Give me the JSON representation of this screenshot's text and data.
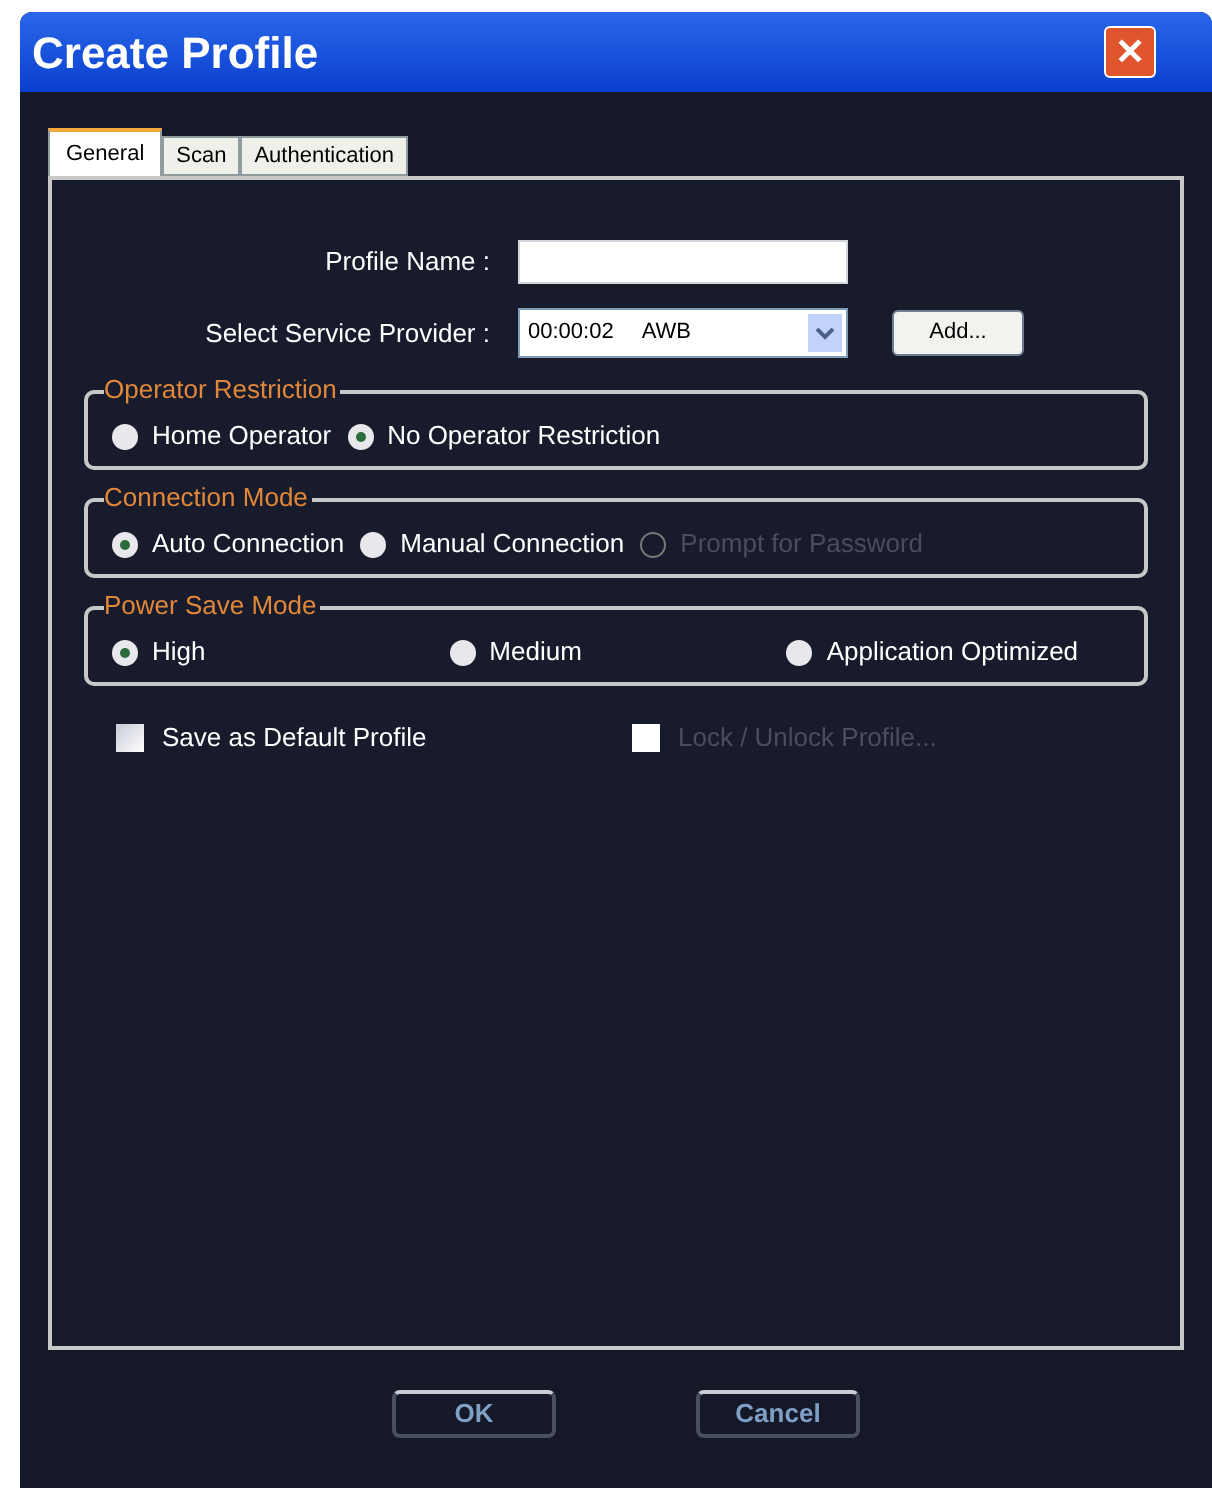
{
  "window": {
    "title": "Create Profile",
    "close": "✕"
  },
  "tabs": [
    {
      "label": "General",
      "selected": true
    },
    {
      "label": "Scan",
      "selected": false
    },
    {
      "label": "Authentication",
      "selected": false
    }
  ],
  "profile_name": {
    "label": "Profile Name :"
  },
  "service_provider": {
    "label": "Select Service Provider :",
    "value_id": "00:00:02",
    "value_name": "AWB",
    "button": "Add..."
  },
  "groups": [
    {
      "title": "Operator Restriction",
      "spread": false,
      "options": [
        {
          "label": "Home Operator",
          "selected": false,
          "disabled": false
        },
        {
          "label": "No Operator Restriction",
          "selected": true,
          "disabled": false
        }
      ]
    },
    {
      "title": "Connection Mode",
      "spread": false,
      "options": [
        {
          "label": "Auto Connection",
          "selected": true,
          "disabled": false
        },
        {
          "label": "Manual Connection",
          "selected": false,
          "disabled": false
        },
        {
          "label": "Prompt for Password",
          "selected": false,
          "disabled": true
        }
      ]
    },
    {
      "title": "Power Save Mode",
      "spread": true,
      "options": [
        {
          "label": "High",
          "selected": true,
          "disabled": false
        },
        {
          "label": "Medium",
          "selected": false,
          "disabled": false
        },
        {
          "label": "Application Optimized",
          "selected": false,
          "disabled": false
        }
      ]
    }
  ],
  "checkboxes": [
    {
      "label": "Save as Default Profile",
      "checked": false,
      "disabled": false
    },
    {
      "label": "Lock / Unlock Profile...",
      "checked": false,
      "disabled": true
    }
  ],
  "buttons": [
    "OK",
    "Cancel"
  ]
}
